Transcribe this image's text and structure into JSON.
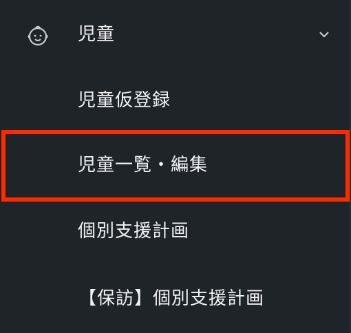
{
  "menu": {
    "header_label": "児童",
    "header_icon": "child-face-icon",
    "chevron_icon": "chevron-down-icon",
    "items": [
      {
        "label": "児童仮登録"
      },
      {
        "label": "児童一覧・編集",
        "highlighted": true
      },
      {
        "label": "個別支援計画"
      },
      {
        "label": "【保訪】個別支援計画"
      }
    ]
  },
  "colors": {
    "background": "#1f2429",
    "text": "#f2f2f2",
    "highlight": "#ff2a00",
    "icon": "#c9cbcd"
  }
}
